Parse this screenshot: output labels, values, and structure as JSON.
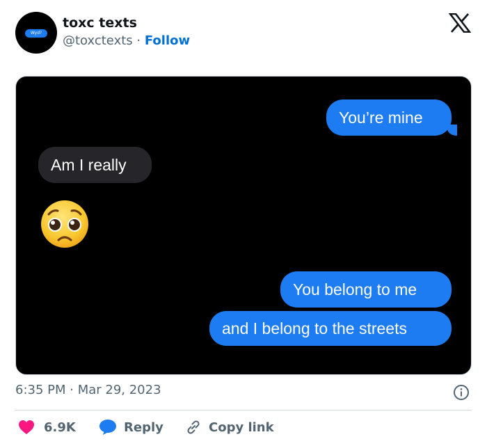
{
  "author": {
    "display_name": "toxc texts",
    "handle": "@toxctexts",
    "separator": "·",
    "follow_label": "Follow",
    "avatar_text": "Wyd?"
  },
  "platform_icon": "x-logo-icon",
  "conversation": {
    "messages": [
      {
        "direction": "sent",
        "text": "You’re mine"
      },
      {
        "direction": "received",
        "text": "Am I really"
      },
      {
        "direction": "received",
        "emoji": "pleading-face-emoji"
      },
      {
        "direction": "sent",
        "text": "You belong to me"
      },
      {
        "direction": "sent",
        "text": "and I belong to the streets"
      }
    ]
  },
  "footer": {
    "timestamp": "6:35 PM · Mar 29, 2023",
    "like_count": "6.9K",
    "reply_label": "Reply",
    "copy_link_label": "Copy link"
  },
  "colors": {
    "accent": "#006fd6",
    "imessage_blue": "#1d7cf2",
    "received_bubble": "#26262a",
    "like_red": "#f91880",
    "muted_text": "#536471"
  }
}
